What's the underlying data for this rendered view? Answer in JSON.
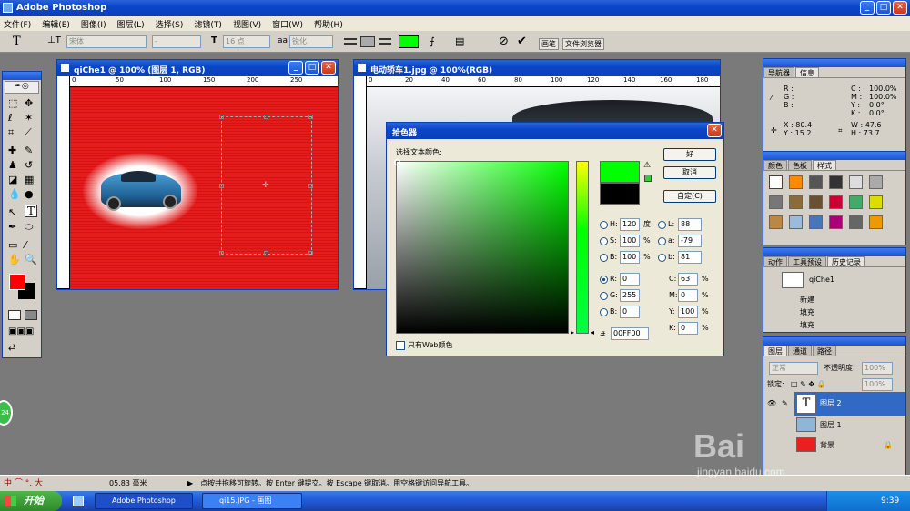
{
  "app": {
    "title": "Adobe Photoshop"
  },
  "menu": [
    "文件(F)",
    "编辑(E)",
    "图像(I)",
    "图层(L)",
    "选择(S)",
    "滤镜(T)",
    "视图(V)",
    "窗口(W)",
    "帮助(H)"
  ],
  "options": {
    "font": "宋体",
    "style": "-",
    "size": "16 点",
    "aa_label": "aa",
    "aa": "锐化",
    "tab1": "画笔",
    "tab2": "文件浏览器"
  },
  "doc1": {
    "title": "qiChe1 @ 100% (图层 1, RGB)",
    "zoom_label": "01"
  },
  "doc2": {
    "title": "电动轿车1.jpg @ 100%(RGB)"
  },
  "ruler_marks": [
    "0",
    "50",
    "100",
    "150",
    "200",
    "250"
  ],
  "ruler2_marks": [
    "0",
    "20",
    "40",
    "60",
    "80",
    "100",
    "120",
    "140",
    "160",
    "180"
  ],
  "color_picker": {
    "title": "拾色器",
    "subtitle": "选择文本颜色:",
    "ok": "好",
    "cancel": "取消",
    "custom": "自定(C)",
    "H": "120",
    "H_unit": "度",
    "S": "100",
    "B": "100",
    "R": "0",
    "G": "255",
    "Bv": "0",
    "L": "88",
    "a": "-79",
    "b": "81",
    "C": "63",
    "M": "0",
    "Y": "100",
    "K": "0",
    "hex": "00FF00",
    "web_only": "只有Web颜色",
    "new_color": "#00ff00",
    "old_color": "#000000"
  },
  "navigator": {
    "tab1": "导航器",
    "tab2": "信息",
    "R": "R :",
    "G": "G :",
    "B": "B :",
    "C": "C :",
    "M": "M :",
    "Y": "Y :",
    "K": "K :",
    "Cv": "100.0%",
    "Mv": "100.0%",
    "Yv": "0.0°",
    "Kv": "0.0°",
    "x": "X : 80.4",
    "y": "Y : 15.2",
    "w": "W : 47.6",
    "h": "H : 73.7"
  },
  "styles": {
    "tab1": "颜色",
    "tab2": "色板",
    "tab3": "样式"
  },
  "history": {
    "tab1": "动作",
    "tab2": "工具预设",
    "tab3": "历史记录",
    "doc": "qiChe1",
    "items": [
      "新建",
      "填充",
      "填充"
    ]
  },
  "layers": {
    "tab1": "图层",
    "tab2": "通道",
    "tab3": "路径",
    "blend": "正常",
    "opacity_label": "不透明度:",
    "opacity": "100%",
    "lock_label": "锁定:",
    "fill": "100%",
    "items": [
      "图层 2",
      "图层 1",
      "背景"
    ]
  },
  "status": {
    "zoom": "05.83 毫米",
    "hint": "点按并拖移可旋转。按 Enter 键提交。按 Escape 键取消。用空格键访问导航工具。"
  },
  "taskbar": {
    "start": "开始",
    "task1": "Adobe Photoshop",
    "task2": "qi15.JPG - 画图",
    "time": "9:39"
  },
  "ime": "中 ⌒ °, 大",
  "watermark": {
    "line1": "Bai",
    "line2": "jingyan.baidu.com"
  },
  "car_badge": "24",
  "colors": {
    "fg": "#ff0000",
    "bg": "#000000",
    "canvas": "#e82020"
  }
}
